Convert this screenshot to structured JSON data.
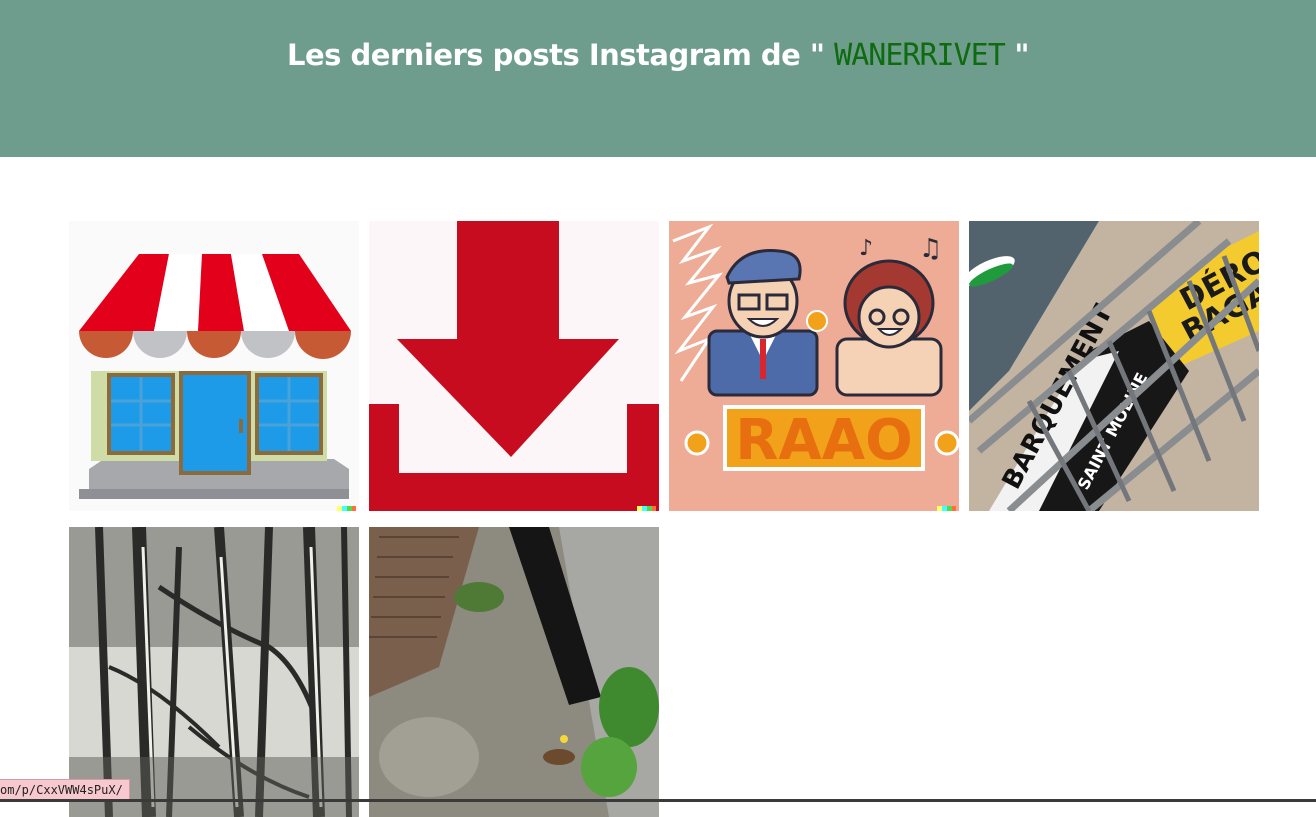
{
  "header": {
    "title_prefix": "Les derniers posts Instagram de \" ",
    "username": "WANERRIVET",
    "title_suffix": " \""
  },
  "colors": {
    "header_bg": "#6f9d8d",
    "username": "#0f6b0f"
  },
  "posts": [
    {
      "alt": "shop"
    },
    {
      "alt": "download"
    },
    {
      "alt": "RAAO",
      "image_text": "RAAO"
    },
    {
      "alt": "barrier",
      "image_text": [
        "DÉROS",
        "BAGAG",
        "BARQUEMENT",
        "SAINT MOLINE"
      ]
    },
    {
      "alt": "forest"
    },
    {
      "alt": "pavement"
    }
  ],
  "statusbar": {
    "url": "om/p/CxxVWW4sPuX/"
  }
}
